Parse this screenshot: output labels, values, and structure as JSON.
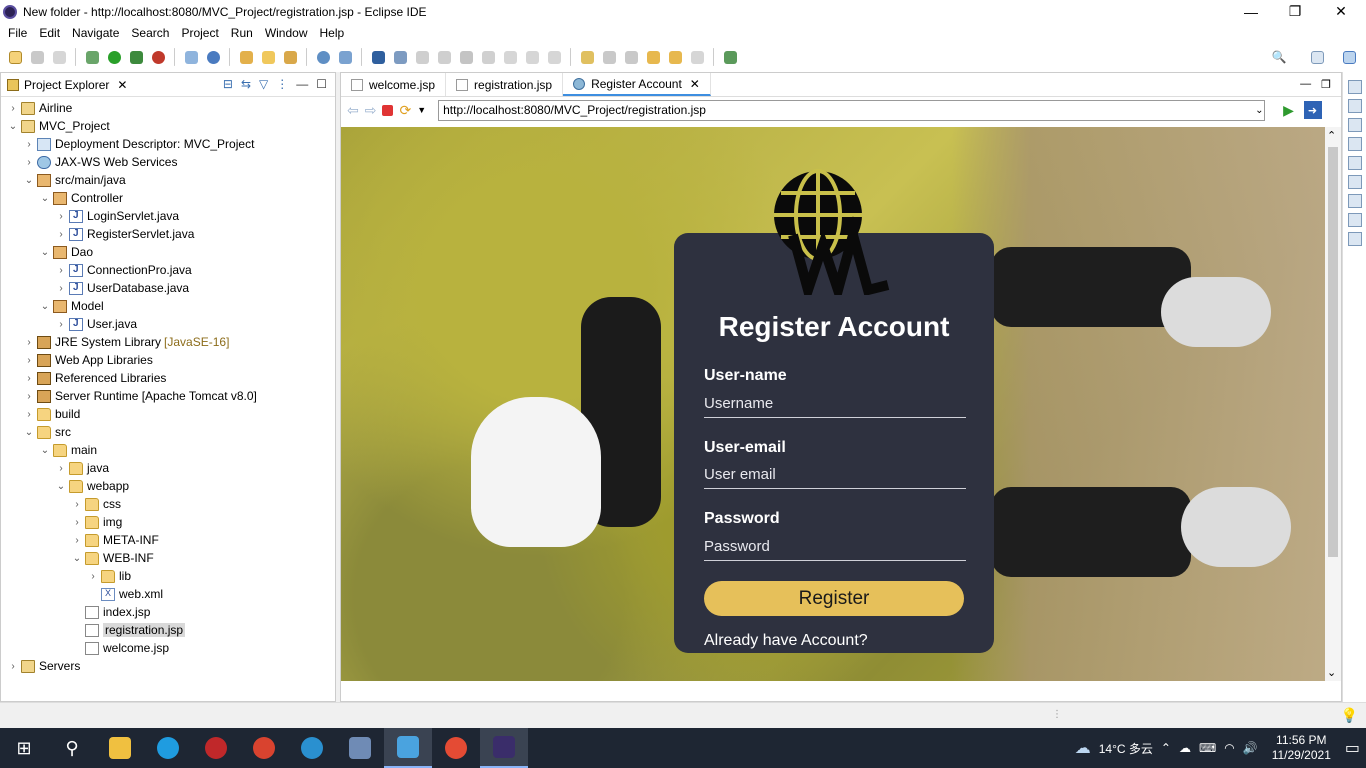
{
  "window": {
    "title": "New folder - http://localhost:8080/MVC_Project/registration.jsp - Eclipse IDE",
    "minimize": "—",
    "maximize": "❐",
    "close": "✕"
  },
  "menu": [
    "File",
    "Edit",
    "Navigate",
    "Search",
    "Project",
    "Run",
    "Window",
    "Help"
  ],
  "explorer": {
    "title": "Project Explorer",
    "tree": [
      {
        "label": "Airline",
        "level": 0,
        "twisty": "›",
        "icon": "project"
      },
      {
        "label": "MVC_Project",
        "level": 0,
        "twisty": "⌄",
        "icon": "project"
      },
      {
        "label": "Deployment Descriptor: MVC_Project",
        "level": 1,
        "twisty": "›",
        "icon": "desc"
      },
      {
        "label": "JAX-WS Web Services",
        "level": 1,
        "twisty": "›",
        "icon": "ws"
      },
      {
        "label": "src/main/java",
        "level": 1,
        "twisty": "⌄",
        "icon": "package"
      },
      {
        "label": "Controller",
        "level": 2,
        "twisty": "⌄",
        "icon": "package"
      },
      {
        "label": "LoginServlet.java",
        "level": 3,
        "twisty": "›",
        "icon": "java"
      },
      {
        "label": "RegisterServlet.java",
        "level": 3,
        "twisty": "›",
        "icon": "java"
      },
      {
        "label": "Dao",
        "level": 2,
        "twisty": "⌄",
        "icon": "package"
      },
      {
        "label": "ConnectionPro.java",
        "level": 3,
        "twisty": "›",
        "icon": "java"
      },
      {
        "label": "UserDatabase.java",
        "level": 3,
        "twisty": "›",
        "icon": "java"
      },
      {
        "label": "Model",
        "level": 2,
        "twisty": "⌄",
        "icon": "package"
      },
      {
        "label": "User.java",
        "level": 3,
        "twisty": "›",
        "icon": "java"
      },
      {
        "label": "JRE System Library",
        "hint": "[JavaSE-16]",
        "level": 1,
        "twisty": "›",
        "icon": "lib"
      },
      {
        "label": "Web App Libraries",
        "level": 1,
        "twisty": "›",
        "icon": "lib"
      },
      {
        "label": "Referenced Libraries",
        "level": 1,
        "twisty": "›",
        "icon": "lib"
      },
      {
        "label": "Server Runtime [Apache Tomcat v8.0]",
        "level": 1,
        "twisty": "›",
        "icon": "lib"
      },
      {
        "label": "build",
        "level": 1,
        "twisty": "›",
        "icon": "folder"
      },
      {
        "label": "src",
        "level": 1,
        "twisty": "⌄",
        "icon": "folder"
      },
      {
        "label": "main",
        "level": 2,
        "twisty": "⌄",
        "icon": "folder"
      },
      {
        "label": "java",
        "level": 3,
        "twisty": "›",
        "icon": "folder"
      },
      {
        "label": "webapp",
        "level": 3,
        "twisty": "⌄",
        "icon": "folder"
      },
      {
        "label": "css",
        "level": 4,
        "twisty": "›",
        "icon": "folder"
      },
      {
        "label": "img",
        "level": 4,
        "twisty": "›",
        "icon": "folder"
      },
      {
        "label": "META-INF",
        "level": 4,
        "twisty": "›",
        "icon": "folder"
      },
      {
        "label": "WEB-INF",
        "level": 4,
        "twisty": "⌄",
        "icon": "folder"
      },
      {
        "label": "lib",
        "level": 5,
        "twisty": "›",
        "icon": "folder"
      },
      {
        "label": "web.xml",
        "level": 5,
        "twisty": "",
        "icon": "xml"
      },
      {
        "label": "index.jsp",
        "level": 4,
        "twisty": "",
        "icon": "jsp"
      },
      {
        "label": "registration.jsp",
        "level": 4,
        "twisty": "",
        "icon": "jsp",
        "selected": true
      },
      {
        "label": "welcome.jsp",
        "level": 4,
        "twisty": "",
        "icon": "jsp"
      },
      {
        "label": "Servers",
        "level": 0,
        "twisty": "›",
        "icon": "project"
      }
    ]
  },
  "editor": {
    "tabs": [
      {
        "label": "welcome.jsp",
        "icon": "file",
        "active": false
      },
      {
        "label": "registration.jsp",
        "icon": "file",
        "active": false
      },
      {
        "label": "Register Account",
        "icon": "globe",
        "active": true
      }
    ],
    "url": "http://localhost:8080/MVC_Project/registration.jsp"
  },
  "form": {
    "heading": "Register Account",
    "username_label": "User-name",
    "username_placeholder": "Username",
    "email_label": "User-email",
    "email_placeholder": "User email",
    "password_label": "Password",
    "password_placeholder": "Password",
    "register_label": "Register",
    "login_link": "Already have Account?"
  },
  "taskbar": {
    "weather": "14°C 多云",
    "time": "11:56 PM",
    "date": "11/29/2021"
  },
  "colors": {
    "card": "#2e313f",
    "button": "#e6c05a",
    "taskbar": "#1e2633"
  }
}
